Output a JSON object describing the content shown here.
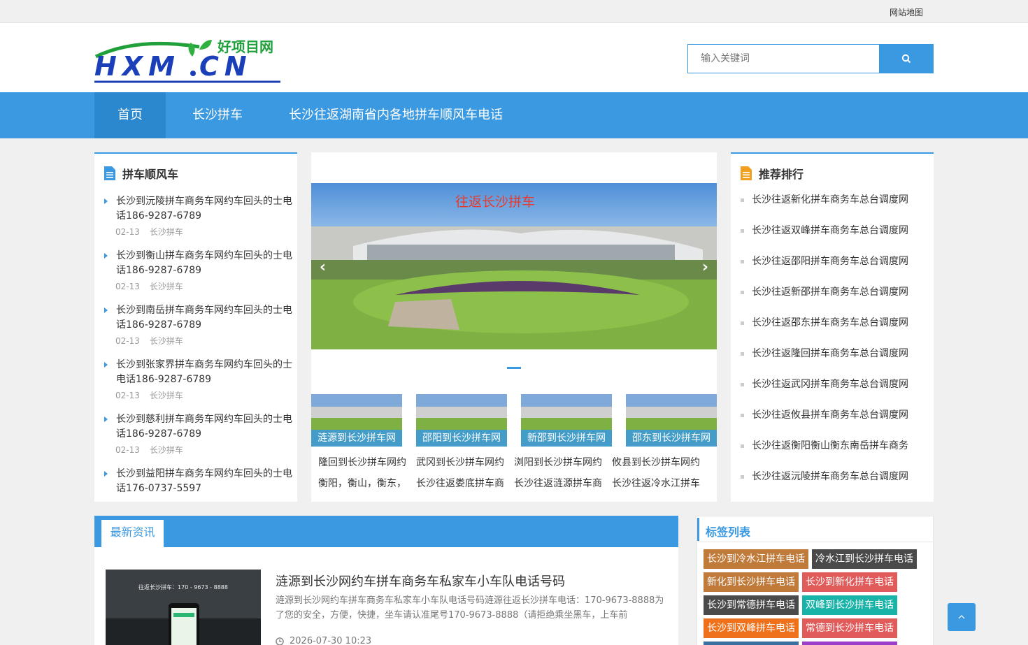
{
  "topbar": {
    "sitemap": "网站地图"
  },
  "logo": {
    "cn_text": "好项目网",
    "en_text": "HXM.CN"
  },
  "search": {
    "placeholder": "输入关键词"
  },
  "nav": {
    "items": [
      "首页",
      "长沙拼车",
      "长沙往返湖南省内各地拼车顺风车电话"
    ]
  },
  "left": {
    "title": "拼车顺风车",
    "posts": [
      {
        "title": "长沙到沅陵拼车商务车网约车回头的士电话186-9287-6789",
        "date": "02-13",
        "cat": "长沙拼车"
      },
      {
        "title": "长沙到衡山拼车商务车网约车回头的士电话186-9287-6789",
        "date": "02-13",
        "cat": "长沙拼车"
      },
      {
        "title": "长沙到南岳拼车商务车网约车回头的士电话186-9287-6789",
        "date": "02-13",
        "cat": "长沙拼车"
      },
      {
        "title": "长沙到张家界拼车商务车网约车回头的士电话186-9287-6789",
        "date": "02-13",
        "cat": "长沙拼车"
      },
      {
        "title": "长沙到慈利拼车商务车网约车回头的士电话186-9287-6789",
        "date": "02-13",
        "cat": "长沙拼车"
      },
      {
        "title": "长沙到益阳拼车商务车网约车回头的士电话176-0737-5597",
        "date": "",
        "cat": ""
      }
    ]
  },
  "slider": {
    "caption": "往返长沙拼车"
  },
  "thumbs": [
    {
      "label": "涟源到长沙拼车网",
      "line1": "隆回到长沙拼车网约",
      "line2": "衡阳，衡山，衡东，"
    },
    {
      "label": "邵阳到长沙拼车网",
      "line1": "武冈到长沙拼车网约",
      "line2": "长沙往返娄底拼车商"
    },
    {
      "label": "新邵到长沙拼车网",
      "line1": "浏阳到长沙拼车网约",
      "line2": "长沙往返涟源拼车商"
    },
    {
      "label": "邵东到长沙拼车网",
      "line1": "攸县到长沙拼车网约",
      "line2": "长沙往返冷水江拼车"
    }
  ],
  "right": {
    "title": "推荐排行",
    "items": [
      "长沙往返新化拼车商务车总台调度网",
      "长沙往返双峰拼车商务车总台调度网",
      "长沙往返邵阳拼车商务车总台调度网",
      "长沙往返新邵拼车商务车总台调度网",
      "长沙往返邵东拼车商务车总台调度网",
      "长沙往返隆回拼车商务车总台调度网",
      "长沙往返武冈拼车商务车总台调度网",
      "长沙往返攸县拼车商务车总台调度网",
      "长沙往返衡阳衡山衡东南岳拼车商务",
      "长沙往返沅陵拼车商务车总台调度网"
    ]
  },
  "news": {
    "tab": "最新资讯",
    "img_text": "往返长沙拼车：170 - 9673 - 8888",
    "title": "涟源到长沙网约车拼车商务车私家车小车队电话号码",
    "desc": "涟源到长沙网约车拼车商务车私家车小车队电话号码涟源往返长沙拼车电话：170-9673-8888为了您的安全，方便，快捷，坐车请认准尾号170-9673-8888（请拒绝乘坐黑车，上车前",
    "date": "2026-07-30 10:23"
  },
  "tags": {
    "title": "标签列表",
    "items": [
      {
        "label": "长沙到冷水江拼车电话",
        "color": "#c07a3a"
      },
      {
        "label": "冷水江到长沙拼车电话",
        "color": "#4a4a4a"
      },
      {
        "label": "新化到长沙拼车电话",
        "color": "#c07a3a"
      },
      {
        "label": "长沙到新化拼车电话",
        "color": "#e25b5b"
      },
      {
        "label": "长沙到常德拼车电话",
        "color": "#4a4a4a"
      },
      {
        "label": "双峰到长沙拼车电话",
        "color": "#1ab3a8"
      },
      {
        "label": "长沙到双峰拼车电话",
        "color": "#f0711c"
      },
      {
        "label": "常德到长沙拼车电话",
        "color": "#e25b5b"
      }
    ]
  },
  "colors": {
    "primary": "#3a99e0",
    "nav_active": "#2b88cf",
    "caption_red": "#e63b2e"
  }
}
